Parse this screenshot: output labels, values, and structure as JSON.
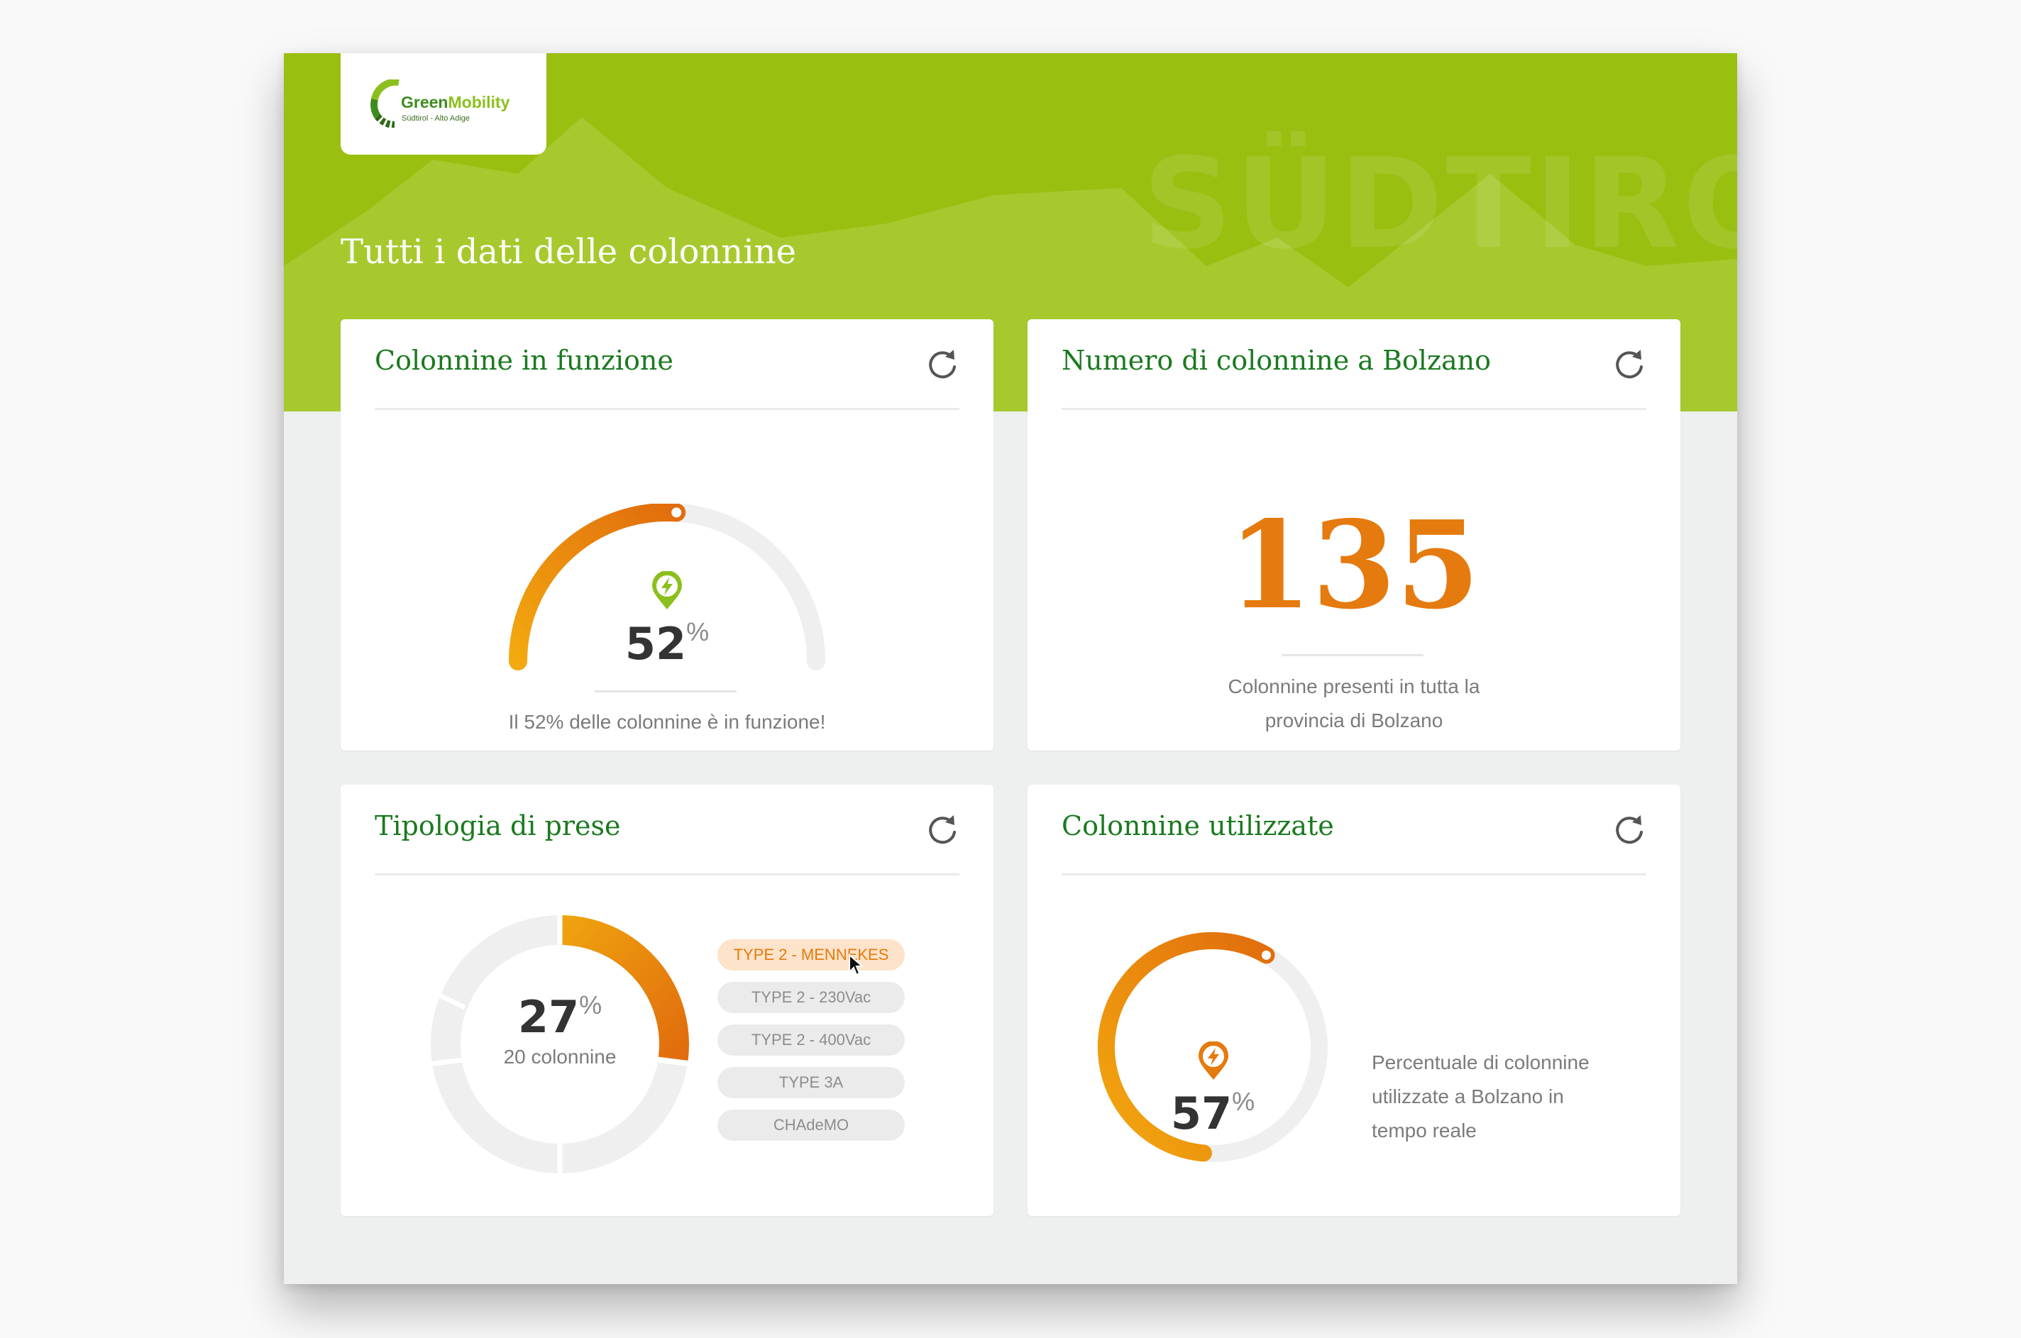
{
  "brand": {
    "name_part1": "Green",
    "name_part2": "Mobility",
    "subtitle": "Südtirol - Alto Adige",
    "watermark": "SÜDTIROL"
  },
  "colors": {
    "banner": "#99bf10",
    "title_green": "#1a7a1f",
    "orange": "#e57a0e",
    "gold": "#efa20f"
  },
  "page": {
    "title": "Tutti i dati delle colonnine"
  },
  "cards": {
    "working": {
      "title": "Colonnine in funzione",
      "icon": "charging-pin-icon",
      "value": "52",
      "unit": "%",
      "fraction": 0.52,
      "caption": "Il 52% delle colonnine è in funzione!"
    },
    "count": {
      "title": "Numero di colonnine a Bolzano",
      "value": "135",
      "caption_line1": "Colonnine presenti in tutta la",
      "caption_line2": "provincia di Bolzano"
    },
    "sockets": {
      "title": "Tipologia di prese",
      "value": "27",
      "unit": "%",
      "fraction": 0.27,
      "subcaption": "20 colonnine",
      "types": [
        "TYPE 2 - MENNEKES",
        "TYPE 2 - 230Vac",
        "TYPE 2 - 400Vac",
        "TYPE 3A",
        "CHAdeMO"
      ],
      "selected": "TYPE 2 - MENNEKES"
    },
    "used": {
      "title": "Colonnine utilizzate",
      "icon": "charging-pin-icon",
      "value": "57",
      "unit": "%",
      "fraction": 0.57,
      "description_line1": "Percentuale di colonnine",
      "description_line2": "utilizzate a Bolzano in",
      "description_line3": "tempo reale"
    }
  }
}
